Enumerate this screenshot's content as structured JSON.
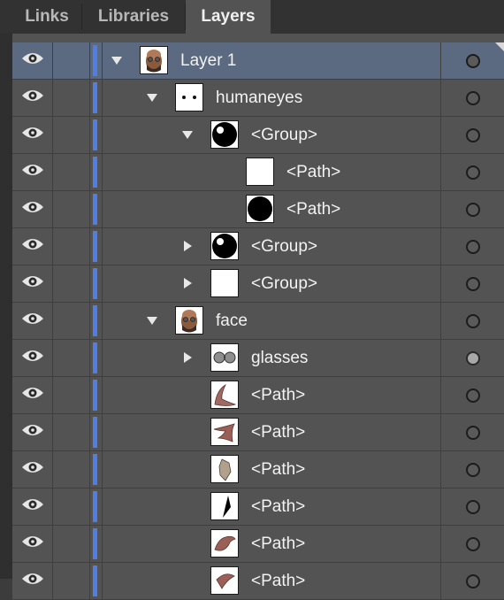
{
  "tabs": [
    {
      "label": "Links",
      "active": false
    },
    {
      "label": "Libraries",
      "active": false
    },
    {
      "label": "Layers",
      "active": true
    }
  ],
  "colors": {
    "layer_color": "#4f7fe6",
    "selected_row": "#5b6a80",
    "panel_bg": "#535353"
  },
  "layers": [
    {
      "name": "Layer 1",
      "depth": 0,
      "twisty": "expanded",
      "thumb": "face-thumb",
      "target": "empty",
      "selected": true
    },
    {
      "name": "humaneyes",
      "depth": 1,
      "twisty": "expanded",
      "thumb": "eyes-thumb",
      "target": "empty"
    },
    {
      "name": "<Group>",
      "depth": 2,
      "twisty": "expanded",
      "thumb": "eyeball-thumb",
      "target": "empty"
    },
    {
      "name": "<Path>",
      "depth": 3,
      "twisty": "none",
      "thumb": "blank-thumb",
      "target": "empty"
    },
    {
      "name": "<Path>",
      "depth": 3,
      "twisty": "none",
      "thumb": "black-circle-thumb",
      "target": "empty"
    },
    {
      "name": "<Group>",
      "depth": 2,
      "twisty": "collapsed",
      "thumb": "eyeball-thumb",
      "target": "empty"
    },
    {
      "name": "<Group>",
      "depth": 2,
      "twisty": "collapsed",
      "thumb": "blank-thumb",
      "target": "empty"
    },
    {
      "name": "face",
      "depth": 1,
      "twisty": "expanded",
      "thumb": "face-thumb",
      "target": "empty"
    },
    {
      "name": "glasses",
      "depth": 2,
      "twisty": "collapsed",
      "thumb": "glasses-thumb",
      "target": "filled"
    },
    {
      "name": "<Path>",
      "depth": 2,
      "twisty": "none",
      "thumb": "path-shape-1-thumb",
      "target": "empty"
    },
    {
      "name": "<Path>",
      "depth": 2,
      "twisty": "none",
      "thumb": "path-shape-2-thumb",
      "target": "empty"
    },
    {
      "name": "<Path>",
      "depth": 2,
      "twisty": "none",
      "thumb": "path-shape-3-thumb",
      "target": "empty"
    },
    {
      "name": "<Path>",
      "depth": 2,
      "twisty": "none",
      "thumb": "path-shape-4-thumb",
      "target": "empty"
    },
    {
      "name": "<Path>",
      "depth": 2,
      "twisty": "none",
      "thumb": "path-shape-5-thumb",
      "target": "empty"
    },
    {
      "name": "<Path>",
      "depth": 2,
      "twisty": "none",
      "thumb": "path-shape-6-thumb",
      "target": "empty"
    }
  ]
}
